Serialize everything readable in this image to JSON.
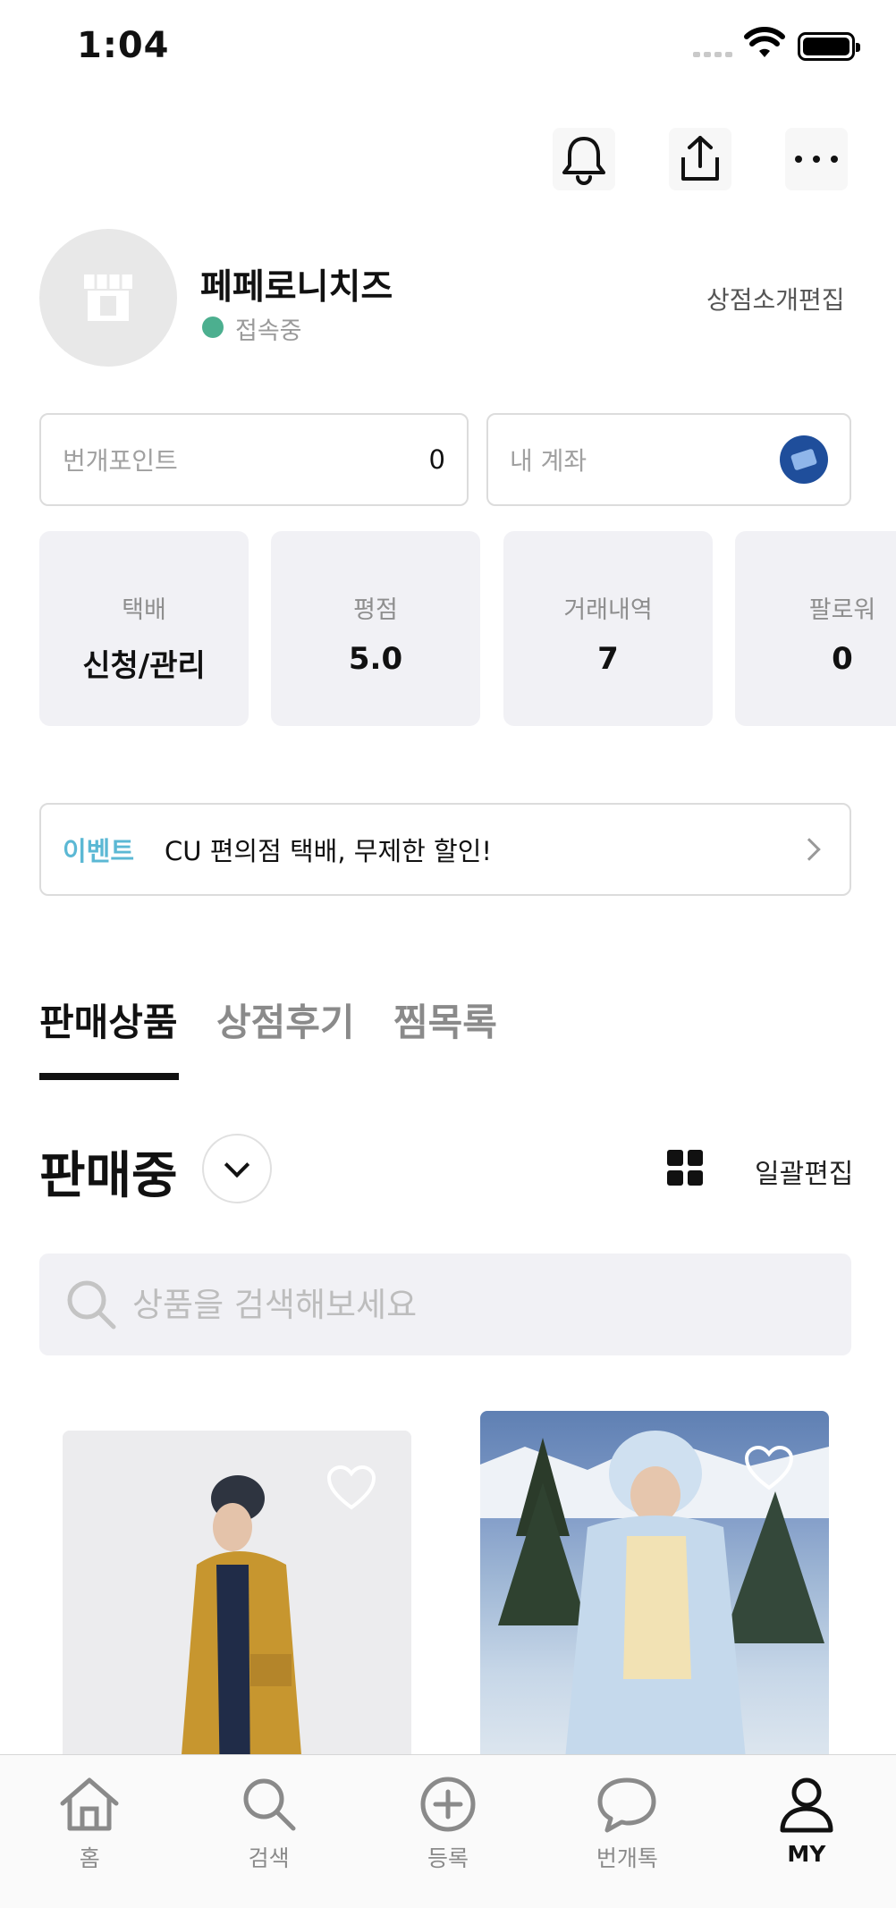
{
  "status_bar": {
    "time": "1:04"
  },
  "profile": {
    "store_name": "페페로니치즈",
    "status": "접속중",
    "edit_intro": "상점소개편집"
  },
  "points": {
    "label": "번개포인트",
    "value": "0"
  },
  "account": {
    "label": "내 계좌"
  },
  "stats": [
    {
      "label": "택배",
      "value": "신청/관리"
    },
    {
      "label": "평점",
      "value": "5.0"
    },
    {
      "label": "거래내역",
      "value": "7"
    },
    {
      "label": "팔로워",
      "value": "0"
    }
  ],
  "event": {
    "tag": "이벤트",
    "message": "CU 편의점 택배, 무제한 할인!"
  },
  "tabs": [
    {
      "label": "판매상품",
      "active": true
    },
    {
      "label": "상점후기",
      "active": false
    },
    {
      "label": "찜목록",
      "active": false
    }
  ],
  "listing": {
    "title": "판매중",
    "bulk_edit": "일괄편집"
  },
  "search": {
    "placeholder": "상품을 검색해보세요"
  },
  "bottom_nav": [
    {
      "label": "홈",
      "icon": "home-icon"
    },
    {
      "label": "검색",
      "icon": "search-icon"
    },
    {
      "label": "등록",
      "icon": "plus-circle-icon"
    },
    {
      "label": "번개톡",
      "icon": "chat-icon"
    },
    {
      "label": "MY",
      "icon": "person-icon",
      "active": true
    }
  ],
  "colors": {
    "accent_event": "#5bb8d4",
    "online": "#4caf8f",
    "card_bg": "#f1f1f5"
  }
}
